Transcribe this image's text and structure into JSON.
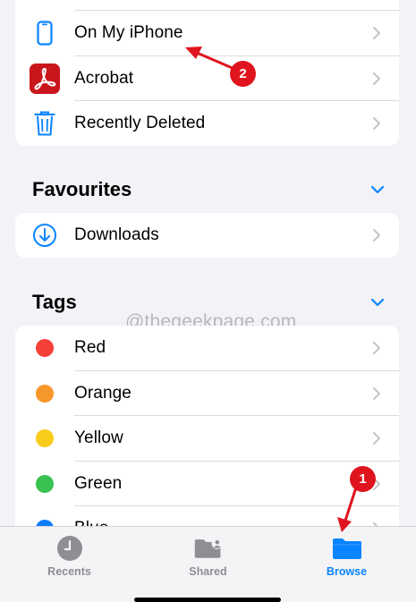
{
  "locations": {
    "items": [
      {
        "label": "On My iPhone",
        "icon": "iphone-icon"
      },
      {
        "label": "Acrobat",
        "icon": "acrobat-icon"
      },
      {
        "label": "Recently Deleted",
        "icon": "trash-icon"
      }
    ]
  },
  "favourites": {
    "title": "Favourites",
    "items": [
      {
        "label": "Downloads",
        "icon": "download-circle-icon"
      }
    ]
  },
  "tags": {
    "title": "Tags",
    "items": [
      {
        "label": "Red",
        "color": "#f5403a"
      },
      {
        "label": "Orange",
        "color": "#f7982b"
      },
      {
        "label": "Yellow",
        "color": "#f8cc1a"
      },
      {
        "label": "Green",
        "color": "#39c152"
      },
      {
        "label": "Blue",
        "color": "#0a7cff"
      }
    ]
  },
  "watermark": "@thegeekpage.com",
  "tabbar": {
    "tabs": [
      {
        "label": "Recents",
        "icon": "clock-icon",
        "active": false
      },
      {
        "label": "Shared",
        "icon": "shared-folder-icon",
        "active": false
      },
      {
        "label": "Browse",
        "icon": "folder-icon",
        "active": true
      }
    ]
  },
  "annotations": {
    "step1": "1",
    "step2": "2"
  },
  "colors": {
    "accent": "#0a84ff",
    "annotation_red": "#e0141e",
    "background": "#f2f2f7"
  }
}
